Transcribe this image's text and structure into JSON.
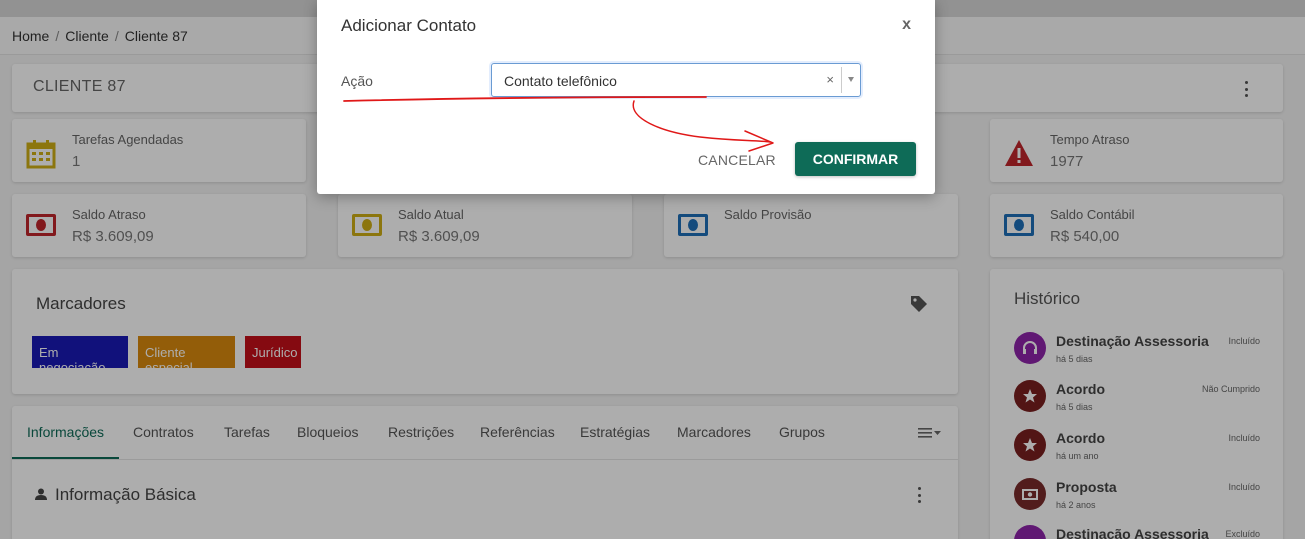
{
  "breadcrumb": {
    "home": "Home",
    "cliente": "Cliente",
    "current": "Cliente 87",
    "separator": "/"
  },
  "client": {
    "title": "CLIENTE 87"
  },
  "stats": {
    "tarefas": {
      "label": "Tarefas Agendadas",
      "value": "1"
    },
    "tempo": {
      "label": "Tempo Atraso",
      "value": "1977"
    },
    "saldo_atraso": {
      "label": "Saldo Atraso",
      "value": "R$ 3.609,09"
    },
    "saldo_atual": {
      "label": "Saldo Atual",
      "value": "R$ 3.609,09"
    },
    "saldo_provisao": {
      "label": "Saldo Provisão",
      "value": ""
    },
    "saldo_contabil": {
      "label": "Saldo Contábil",
      "value": "R$ 540,00"
    }
  },
  "marcadores": {
    "title": "Marcadores",
    "tags": [
      {
        "label": "Em negociação",
        "color": "#1a1ab5"
      },
      {
        "label": "Cliente especial",
        "color": "#d98a0e"
      },
      {
        "label": "Jurídico",
        "color": "#c4101a"
      }
    ]
  },
  "tabs": [
    "Informações",
    "Contratos",
    "Tarefas",
    "Bloqueios",
    "Restrições",
    "Referências",
    "Estratégias",
    "Marcadores",
    "Grupos"
  ],
  "info": {
    "title": "Informação Básica"
  },
  "historico": {
    "title": "Histórico",
    "items": [
      {
        "title": "Destinação Assessoria",
        "sub": "há 5 dias",
        "status": "Incluído",
        "icon": "headset-icon",
        "color": "#8e24aa"
      },
      {
        "title": "Acordo",
        "sub": "há 5 dias",
        "status": "Não Cumprido",
        "icon": "star-icon",
        "color": "#7a1f1f"
      },
      {
        "title": "Acordo",
        "sub": "há um ano",
        "status": "Incluído",
        "icon": "star-icon",
        "color": "#7a1f1f"
      },
      {
        "title": "Proposta",
        "sub": "há 2 anos",
        "status": "Incluído",
        "icon": "money-icon",
        "color": "#7a2c2c"
      },
      {
        "title": "Destinação Assessoria",
        "sub": "",
        "status": "Excluído",
        "icon": "headset-icon",
        "color": "#8e24aa"
      }
    ]
  },
  "modal": {
    "title": "Adicionar Contato",
    "close": "x",
    "field_label": "Ação",
    "select_value": "Contato telefônico",
    "clear": "×",
    "cancel": "CANCELAR",
    "confirm": "CONFIRMAR"
  },
  "colors": {
    "primary": "#0e6b57"
  }
}
